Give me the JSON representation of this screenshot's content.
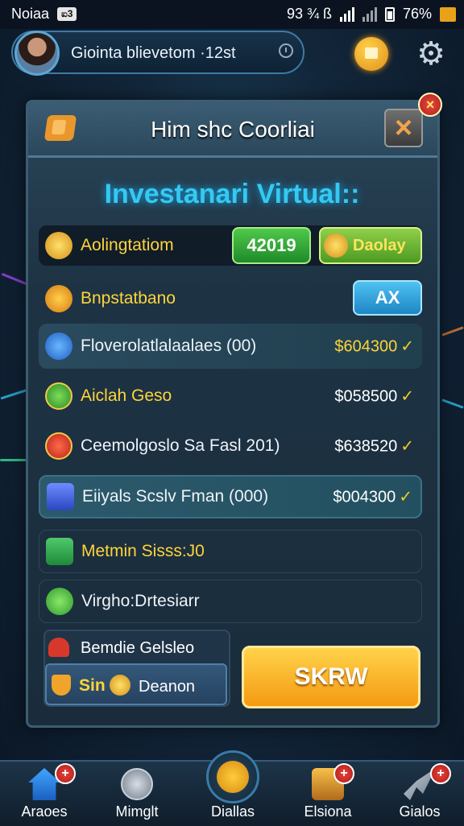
{
  "status_bar": {
    "carrier": "Noiaa",
    "chip": "ಐ3",
    "status_text": "93 ¾ ß",
    "battery": "76%"
  },
  "profile": {
    "name": "Giointa blievetom ·12st"
  },
  "panel": {
    "title": "Him shc Coorliai",
    "close_icon": "×",
    "badge_icon": "×",
    "subtitle": "Investanari Virtual::"
  },
  "rows": [
    {
      "label": "Aolingtatiom",
      "icon": "gold-coin-icon",
      "button": "42019",
      "button2": "Daolay"
    },
    {
      "label": "Bnpstatbano",
      "icon": "dollar-coin-icon",
      "button": "AX"
    },
    {
      "label": "Floverolatlalaalaes (00)",
      "icon": "blue-rocket-icon",
      "value": "$604300",
      "check": "✓"
    },
    {
      "label": "Aiclah Geso",
      "icon": "green-gem-icon",
      "value": "$058500",
      "check": "✓"
    },
    {
      "label": "Ceemolgoslo Sa Fasl 201)",
      "icon": "red-gem-icon",
      "value": "$638520",
      "check": "✓"
    },
    {
      "label": "Eiiyals Scslv Fman (000)",
      "icon": "blue-cube-icon",
      "value": "$004300",
      "check": "✓"
    },
    {
      "label": "Metmin Sisss:J0",
      "icon": "chart-icon"
    },
    {
      "label": "Virgho:Drtesiarr",
      "icon": "green-tag-icon"
    }
  ],
  "bonus": {
    "top_label": "Bemdie Gelsleo",
    "bottom_label_left": "Sin",
    "bottom_label_right": "Deanon",
    "action_button": "SKRW"
  },
  "nav": [
    {
      "label": "Araoes",
      "icon": "home-icon",
      "badge": "+"
    },
    {
      "label": "Mimglt",
      "icon": "compass-icon"
    },
    {
      "label": "Diallas",
      "icon": "gold-disc-icon"
    },
    {
      "label": "Elsiona",
      "icon": "treasure-chest-icon",
      "badge": "+"
    },
    {
      "label": "Gialos",
      "icon": "rocket-icon",
      "badge": "+"
    }
  ],
  "colors": {
    "accent_cyan": "#34c9f2",
    "gold": "#ffd43b",
    "orange": "#f49a12",
    "green": "#4fc94a",
    "panel_bg": "#1d3344"
  }
}
